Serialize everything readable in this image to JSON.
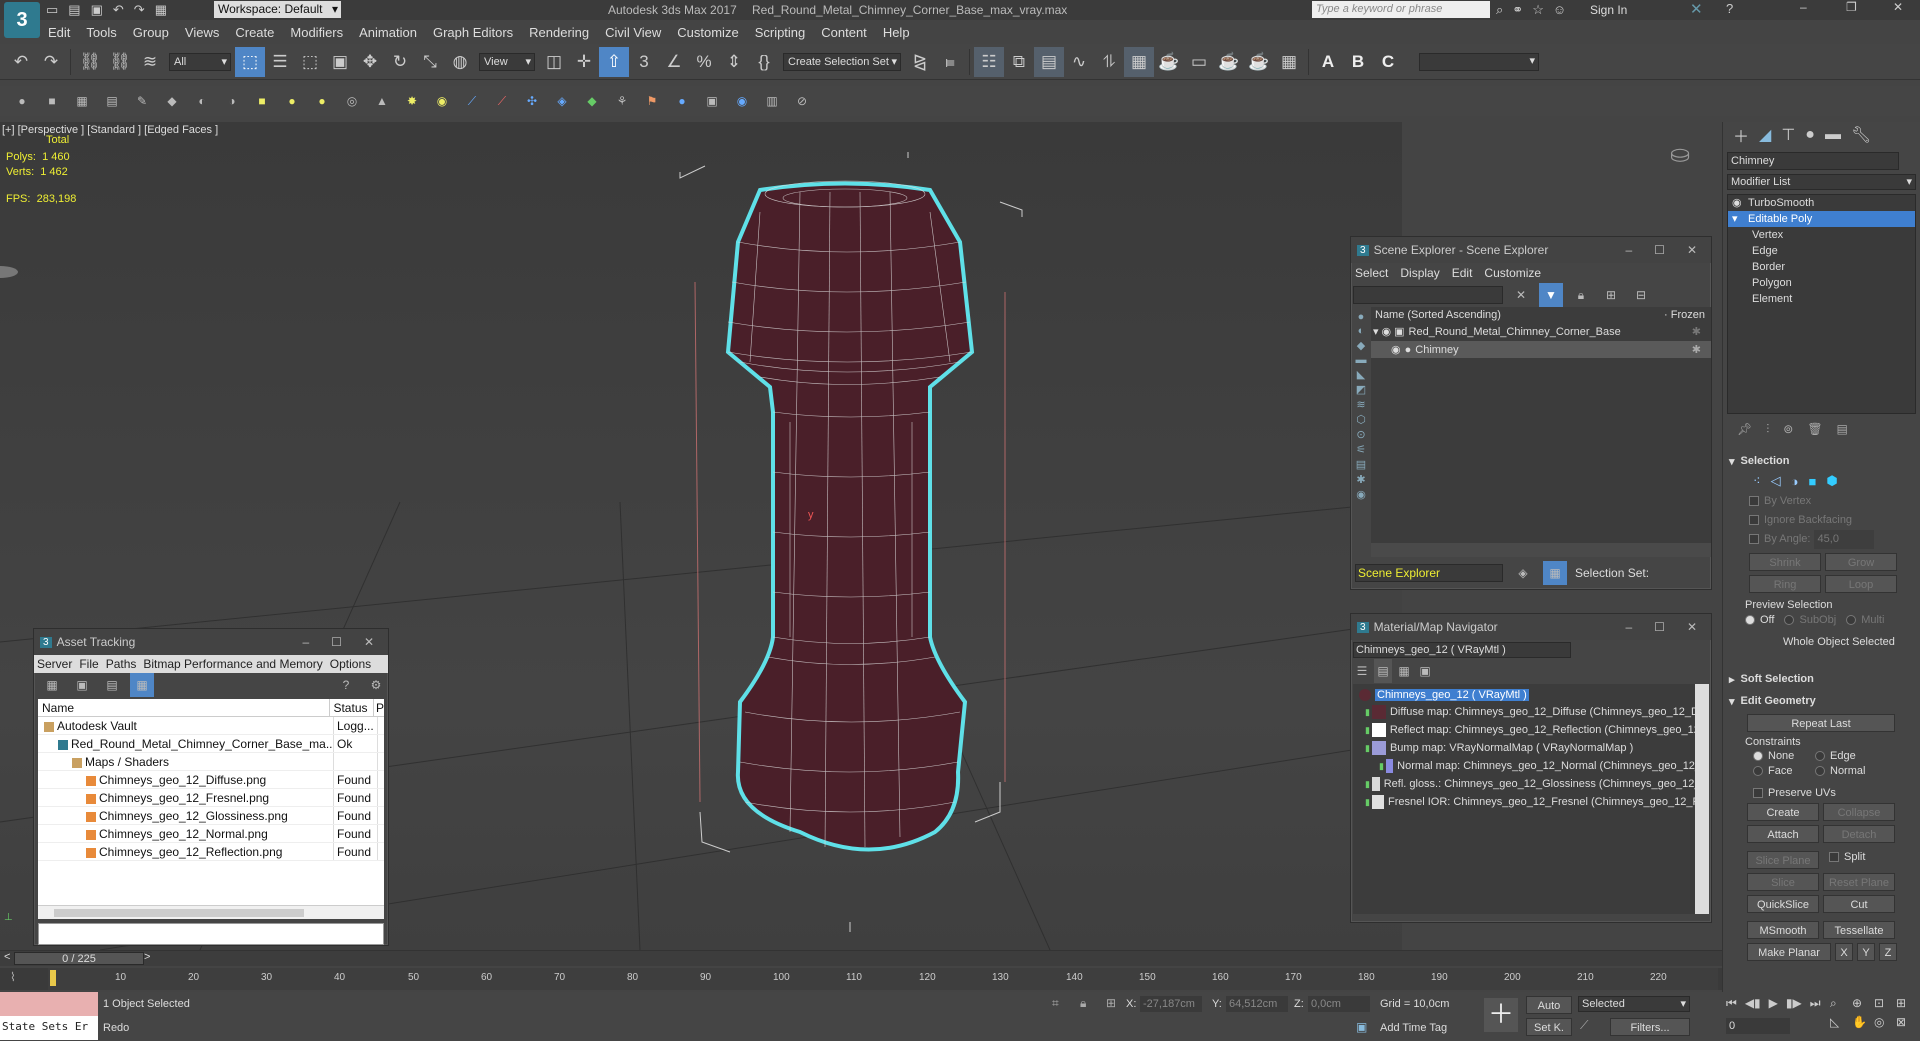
{
  "title_bar": {
    "workspace": "Workspace: Default",
    "app_title": "Autodesk 3ds Max 2017",
    "file_title": "Red_Round_Metal_Chimney_Corner_Base_max_vray.max",
    "search_placeholder": "Type a keyword or phrase",
    "sign_in": "Sign In"
  },
  "menu": [
    "Edit",
    "Tools",
    "Group",
    "Views",
    "Create",
    "Modifiers",
    "Animation",
    "Graph Editors",
    "Rendering",
    "Civil View",
    "Customize",
    "Scripting",
    "Content",
    "Help"
  ],
  "main_toolbar": {
    "filter_value": "All",
    "ref_coord": "View",
    "selection_set": "Create Selection Set"
  },
  "viewport": {
    "label": "[+] [Perspective ] [Standard ] [Edged Faces ]",
    "stats_header": "Total",
    "polys_label": "Polys:",
    "polys_value": "1 460",
    "verts_label": "Verts:",
    "verts_value": "1 462",
    "fps_label": "FPS:",
    "fps_value": "283,198",
    "axis_label": "y"
  },
  "asset_tracking": {
    "title": "Asset Tracking",
    "menu": [
      "Server",
      "File",
      "Paths",
      "Bitmap Performance and Memory",
      "Options"
    ],
    "col_name": "Name",
    "col_status": "Status",
    "col_extra": "P",
    "rows": [
      {
        "name": "Autodesk Vault",
        "status": "Logg...",
        "indent": 0
      },
      {
        "name": "Red_Round_Metal_Chimney_Corner_Base_ma...",
        "status": "Ok",
        "indent": 1
      },
      {
        "name": "Maps / Shaders",
        "status": "",
        "indent": 2
      },
      {
        "name": "Chimneys_geo_12_Diffuse.png",
        "status": "Found",
        "indent": 3
      },
      {
        "name": "Chimneys_geo_12_Fresnel.png",
        "status": "Found",
        "indent": 3
      },
      {
        "name": "Chimneys_geo_12_Glossiness.png",
        "status": "Found",
        "indent": 3
      },
      {
        "name": "Chimneys_geo_12_Normal.png",
        "status": "Found",
        "indent": 3
      },
      {
        "name": "Chimneys_geo_12_Reflection.png",
        "status": "Found",
        "indent": 3
      }
    ]
  },
  "scene_explorer": {
    "title": "Scene Explorer - Scene Explorer",
    "menu": [
      "Select",
      "Display",
      "Edit",
      "Customize"
    ],
    "col_name": "Name (Sorted Ascending)",
    "col_frozen": "· Frozen",
    "root": "Red_Round_Metal_Chimney_Corner_Base",
    "child": "Chimney",
    "footer_name": "Scene Explorer",
    "selection_set_label": "Selection Set:"
  },
  "material_navigator": {
    "title": "Material/Map Navigator",
    "current": "Chimneys_geo_12  ( VRayMtl )",
    "root": "Chimneys_geo_12  ( VRayMtl )",
    "items": [
      {
        "label": "Diffuse map: Chimneys_geo_12_Diffuse (Chimneys_geo_12_Diff",
        "swatch": "#5a2a34"
      },
      {
        "label": "Reflect map: Chimneys_geo_12_Reflection (Chimneys_geo_12_I",
        "swatch": "#ffffff"
      },
      {
        "label": "Bump map: VRayNormalMap  ( VRayNormalMap )",
        "swatch": "#9b9bd8"
      },
      {
        "label": "Normal map: Chimneys_geo_12_Normal (Chimneys_geo_12_N",
        "swatch": "#8a8ae0"
      },
      {
        "label": "Refl. gloss.: Chimneys_geo_12_Glossiness (Chimneys_geo_12_G",
        "swatch": "#d8d8d8"
      },
      {
        "label": "Fresnel IOR: Chimneys_geo_12_Fresnel (Chimneys_geo_12_Fre",
        "swatch": "#e0e0e0"
      }
    ]
  },
  "command_panel": {
    "object_name": "Chimney",
    "modifier_list": "Modifier List",
    "stack": [
      "TurboSmooth",
      "Editable Poly",
      "Vertex",
      "Edge",
      "Border",
      "Polygon",
      "Element"
    ],
    "selection_title": "Selection",
    "by_vertex": "By Vertex",
    "ignore_backfacing": "Ignore Backfacing",
    "by_angle": "By Angle:",
    "by_angle_value": "45,0",
    "shrink": "Shrink",
    "grow": "Grow",
    "ring": "Ring",
    "loop": "Loop",
    "preview_selection": "Preview Selection",
    "off": "Off",
    "subobj": "SubObj",
    "multi": "Multi",
    "whole_object": "Whole Object Selected",
    "soft_selection": "Soft Selection",
    "edit_geometry": "Edit Geometry",
    "repeat_last": "Repeat Last",
    "constraints": "Constraints",
    "none": "None",
    "edge": "Edge",
    "face": "Face",
    "normal": "Normal",
    "preserve_uvs": "Preserve UVs",
    "create": "Create",
    "collapse": "Collapse",
    "attach": "Attach",
    "detach": "Detach",
    "slice_plane": "Slice Plane",
    "split": "Split",
    "slice": "Slice",
    "reset_plane": "Reset Plane",
    "quickslice": "QuickSlice",
    "cut": "Cut",
    "msmooth": "MSmooth",
    "tessellate": "Tessellate",
    "make_planar": "Make Planar",
    "x": "X",
    "y": "Y",
    "z": "Z"
  },
  "timeline": {
    "frame_counter": "0 / 225",
    "ticks": [
      "10",
      "20",
      "30",
      "40",
      "50",
      "60",
      "70",
      "80",
      "90",
      "100",
      "110",
      "120",
      "130",
      "140",
      "150",
      "160",
      "170",
      "180",
      "190",
      "200",
      "210",
      "220"
    ]
  },
  "status_bar": {
    "state_sets": "State Sets Er",
    "objects_selected": "1 Object Selected",
    "prompt": "Redo",
    "x_label": "X:",
    "x_value": "-27,187cm",
    "y_label": "Y:",
    "y_value": "64,512cm",
    "z_label": "Z:",
    "z_value": "0,0cm",
    "grid": "Grid = 10,0cm",
    "add_time_tag": "Add Time Tag",
    "auto": "Auto",
    "selected": "Selected",
    "set_k": "Set K.",
    "filters": "Filters...",
    "frame": "0"
  },
  "colors": {
    "accent_blue": "#3f7fd0",
    "selection_outline": "#5fe0e8",
    "mesh_fill": "#4a1f29",
    "viewport_bg": "#3d3d3d"
  }
}
